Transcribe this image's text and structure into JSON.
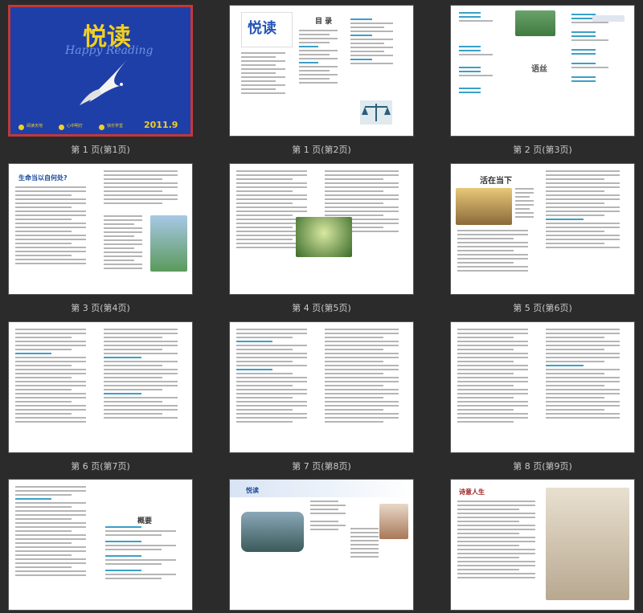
{
  "pages": [
    {
      "caption": "第 1 页(第1页)",
      "selected": true
    },
    {
      "caption": "第 1 页(第2页)",
      "selected": false
    },
    {
      "caption": "第 2 页(第3页)",
      "selected": false
    },
    {
      "caption": "第 3 页(第4页)",
      "selected": false
    },
    {
      "caption": "第 4 页(第5页)",
      "selected": false
    },
    {
      "caption": "第 5 页(第6页)",
      "selected": false
    },
    {
      "caption": "第 6 页(第7页)",
      "selected": false
    },
    {
      "caption": "第 7 页(第8页)",
      "selected": false
    },
    {
      "caption": "第 8 页(第9页)",
      "selected": false
    },
    {
      "caption": "",
      "selected": false
    },
    {
      "caption": "",
      "selected": false
    },
    {
      "caption": "",
      "selected": false
    }
  ],
  "cover": {
    "title": "悦读",
    "subtitle": "Happy Reading",
    "date": "2011.9",
    "tags": [
      "阅读天地",
      "心中明灯",
      "快乐学堂"
    ]
  },
  "contents": {
    "title": "悦读",
    "heading": "目 录"
  },
  "page3": {
    "title": "语丝"
  },
  "page4": {
    "title": "生命当以自何处?"
  },
  "page6": {
    "title": "活在当下"
  },
  "page10": {
    "title": "概要"
  },
  "page11": {
    "title": "悦读"
  },
  "page12": {
    "title": "诗意人生"
  },
  "colors": {
    "background": "#2b2b2b",
    "selected_border": "#c0393b",
    "cover_blue": "#1f3fa8",
    "cover_gold": "#f0d020",
    "caption": "#c8c8c8"
  }
}
